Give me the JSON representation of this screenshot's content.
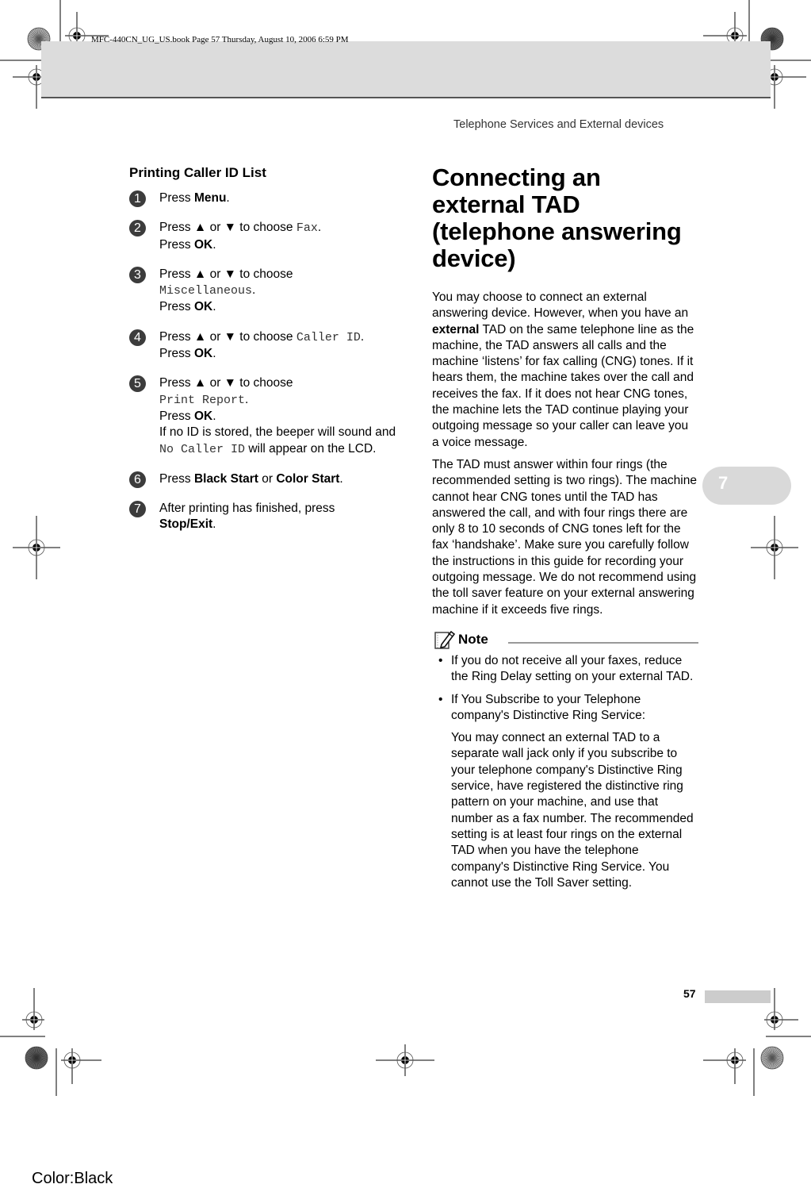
{
  "print_info": {
    "book_line": "MFC-440CN_UG_US.book  Page 57  Thursday, August 10, 2006  6:59 PM",
    "color_label": "Color:Black"
  },
  "header": {
    "chapter_title": "Telephone Services and External devices",
    "chapter_tab_number": "7"
  },
  "footer": {
    "page_number": "57"
  },
  "left_section": {
    "title": "Printing Caller ID List",
    "steps": [
      {
        "num": "1",
        "parts": [
          [
            "t",
            "Press "
          ],
          [
            "b",
            "Menu"
          ],
          [
            "t",
            "."
          ]
        ]
      },
      {
        "num": "2",
        "parts": [
          [
            "t",
            "Press ▲ or ▼ to choose "
          ],
          [
            "m",
            "Fax"
          ],
          [
            "t",
            "."
          ],
          [
            "br",
            ""
          ],
          [
            "t",
            "Press "
          ],
          [
            "b",
            "OK"
          ],
          [
            "t",
            "."
          ]
        ]
      },
      {
        "num": "3",
        "parts": [
          [
            "t",
            "Press ▲ or ▼ to choose"
          ],
          [
            "br",
            ""
          ],
          [
            "m",
            "Miscellaneous"
          ],
          [
            "t",
            "."
          ],
          [
            "br",
            ""
          ],
          [
            "t",
            "Press "
          ],
          [
            "b",
            "OK"
          ],
          [
            "t",
            "."
          ]
        ]
      },
      {
        "num": "4",
        "parts": [
          [
            "t",
            "Press ▲ or ▼ to choose "
          ],
          [
            "m",
            "Caller ID"
          ],
          [
            "t",
            "."
          ],
          [
            "br",
            ""
          ],
          [
            "t",
            "Press "
          ],
          [
            "b",
            "OK"
          ],
          [
            "t",
            "."
          ]
        ]
      },
      {
        "num": "5",
        "parts": [
          [
            "t",
            "Press ▲ or ▼ to choose"
          ],
          [
            "br",
            ""
          ],
          [
            "m",
            "Print Report"
          ],
          [
            "t",
            "."
          ],
          [
            "br",
            ""
          ],
          [
            "t",
            "Press "
          ],
          [
            "b",
            "OK"
          ],
          [
            "t",
            "."
          ],
          [
            "br",
            ""
          ],
          [
            "t",
            "If no ID is stored, the beeper will sound and "
          ],
          [
            "m",
            "No Caller ID"
          ],
          [
            "t",
            " will appear on the LCD."
          ]
        ]
      },
      {
        "num": "6",
        "parts": [
          [
            "t",
            "Press "
          ],
          [
            "b",
            "Black Start"
          ],
          [
            "t",
            " or "
          ],
          [
            "b",
            "Color Start"
          ],
          [
            "t",
            "."
          ]
        ]
      },
      {
        "num": "7",
        "parts": [
          [
            "t",
            "After printing has finished, press "
          ],
          [
            "br",
            ""
          ],
          [
            "b",
            "Stop/Exit"
          ],
          [
            "t",
            "."
          ]
        ]
      }
    ]
  },
  "right_section": {
    "title": "Connecting an external TAD (telephone answering device)",
    "para1_before": "You may choose to connect an external answering device. However, when you have an ",
    "para1_bold": "external",
    "para1_after": " TAD on the same telephone line as the machine, the TAD answers all calls and the machine ‘listens’ for fax calling (CNG) tones. If it hears them, the machine takes over the call and receives the fax. If it does not hear CNG tones, the machine lets the TAD continue playing your outgoing message so your caller can leave you a voice message.",
    "para2": "The TAD must answer within four rings (the recommended setting is two rings). The machine cannot hear CNG tones until the TAD has answered the call, and with four rings there are only 8 to 10 seconds of CNG tones left for the fax ‘handshake’. Make sure you carefully follow the instructions in this guide for recording your outgoing message. We do not recommend using the toll saver feature on your external answering machine if it exceeds five rings.",
    "note": {
      "label": "Note",
      "icon": "note-pencil-icon",
      "bullet_char": "•",
      "bullets": [
        "If you do not receive all your faxes, reduce the Ring Delay setting on your external TAD.",
        "If You Subscribe to your Telephone company's Distinctive Ring Service:"
      ],
      "sub_paragraph": "You may connect an external TAD to a separate wall jack only if you subscribe to your telephone company's Distinctive Ring service, have registered the distinctive ring pattern on your machine, and use that number as a fax number. The recommended setting is at least four rings on the external TAD when you have the telephone company's Distinctive Ring Service. You cannot use the Toll Saver setting."
    }
  }
}
